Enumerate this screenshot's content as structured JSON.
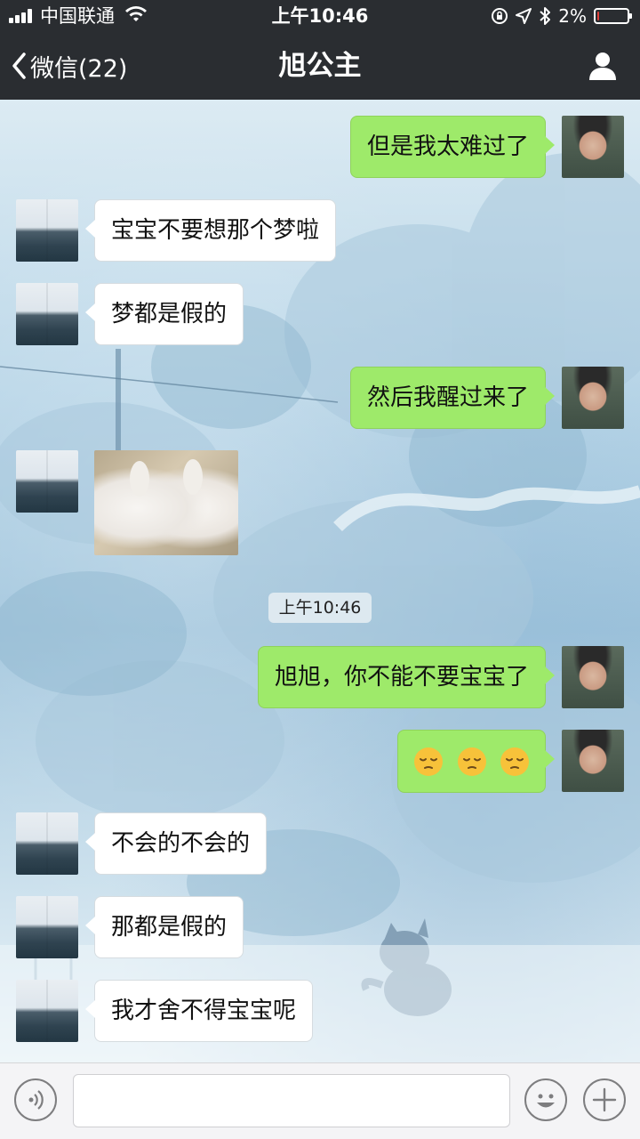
{
  "status_bar": {
    "carrier": "中国联通",
    "time": "上午10:46",
    "battery": "2%",
    "battery_level": 0.02
  },
  "nav": {
    "back_label": "微信(22)",
    "title": "旭公主"
  },
  "messages": [
    {
      "side": "right",
      "text": "但是我太难过了"
    },
    {
      "side": "left",
      "text": "宝宝不要想那个梦啦"
    },
    {
      "side": "left",
      "text": "梦都是假的"
    },
    {
      "side": "right",
      "text": "然后我醒过来了"
    },
    {
      "side": "left",
      "type": "sticker",
      "sticker": "bunnies-sticker"
    },
    {
      "side": "right",
      "text": "旭旭，你不能不要宝宝了"
    },
    {
      "side": "right",
      "type": "emoji",
      "emoji": [
        "pensive-face",
        "pensive-face",
        "pensive-face"
      ]
    },
    {
      "side": "left",
      "text": "不会的不会的"
    },
    {
      "side": "left",
      "text": "那都是假的"
    },
    {
      "side": "left",
      "text": "我才舍不得宝宝呢"
    }
  ],
  "timestamp": "上午10:46",
  "input_bar": {
    "voice_icon": "voice-icon",
    "emoji_icon": "emoji-icon",
    "plus_icon": "plus-icon",
    "placeholder": ""
  },
  "colors": {
    "nav_background": "#2a2d31",
    "sent_bubble": "#9eea6a",
    "received_bubble": "#ffffff"
  }
}
